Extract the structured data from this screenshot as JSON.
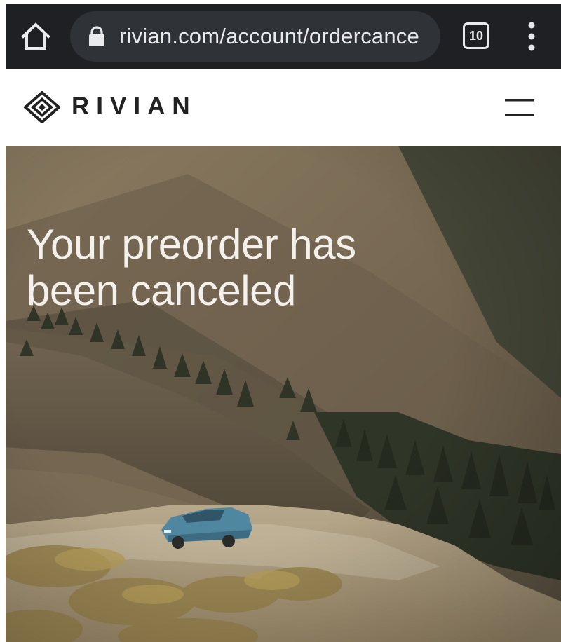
{
  "browser": {
    "url": "rivian.com/account/ordercance",
    "tab_count": "10",
    "icons": {
      "home": "home-icon",
      "lock": "lock-icon",
      "tabs": "tab-switcher-icon",
      "menu": "more-vert-icon"
    },
    "colors": {
      "toolbar": "#1f2023",
      "url_pill": "#2f3236",
      "text": "#e8eaed"
    }
  },
  "site_header": {
    "brand": "RIVIAN",
    "icons": {
      "logo": "rivian-compass-logo-icon",
      "menu": "hamburger-menu-icon"
    }
  },
  "hero": {
    "title": "Your preorder has been canceled",
    "image": "mountain-valley-with-blue-truck"
  }
}
